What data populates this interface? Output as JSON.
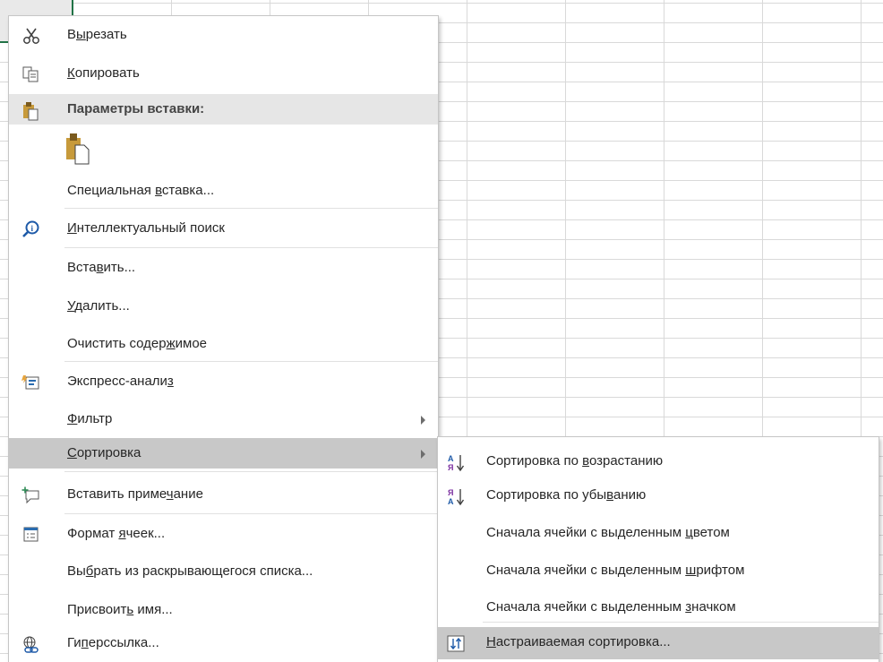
{
  "context_menu": {
    "cut": {
      "pre": "В",
      "key": "ы",
      "post": "резать"
    },
    "copy": {
      "pre": "",
      "key": "К",
      "post": "опировать"
    },
    "paste_options_header": "Параметры вставки:",
    "paste_special": {
      "pre": "Специальная ",
      "key": "в",
      "post": "ставка..."
    },
    "smart_lookup": {
      "pre": "",
      "key": "И",
      "post": "нтеллектуальный поиск"
    },
    "insert": {
      "pre": "Вста",
      "key": "в",
      "post": "ить..."
    },
    "delete": {
      "pre": "",
      "key": "У",
      "post": "далить..."
    },
    "clear_contents": {
      "pre": "Очистить содер",
      "key": "ж",
      "post": "имое"
    },
    "quick_analysis": {
      "pre": "Экспресс-анали",
      "key": "з",
      "post": ""
    },
    "filter": {
      "pre": "",
      "key": "Ф",
      "post": "ильтр"
    },
    "sort": {
      "pre": "",
      "key": "С",
      "post": "ортировка"
    },
    "insert_comment": {
      "pre": "Вставить приме",
      "key": "ч",
      "post": "ание"
    },
    "format_cells": {
      "pre": "Формат ",
      "key": "я",
      "post": "чеек..."
    },
    "pick_from_list": {
      "pre": "Вы",
      "key": "б",
      "post": "рать из раскрывающегося списка..."
    },
    "define_name": {
      "pre": "Присвоит",
      "key": "ь",
      "post": " имя..."
    },
    "hyperlink": {
      "pre": "Ги",
      "key": "п",
      "post": "ерссылка..."
    }
  },
  "sort_submenu": {
    "ascending": {
      "pre": "Сортировка по ",
      "key": "в",
      "post": "озрастанию"
    },
    "descending": {
      "pre": "Сортировка по убы",
      "key": "в",
      "post": "анию"
    },
    "color_first": {
      "pre": "Сначала ячейки с выделенным ",
      "key": "ц",
      "post": "ветом"
    },
    "font_first": {
      "pre": "Сначала ячейки с выделенным ",
      "key": "ш",
      "post": "рифтом"
    },
    "icon_first": {
      "pre": "Сначала ячейки с выделенным ",
      "key": "з",
      "post": "начком"
    },
    "custom_sort": {
      "pre": "",
      "key": "Н",
      "post": "астраиваемая сортировка..."
    },
    "icon_letters": {
      "a": "А",
      "ya": "Я"
    }
  },
  "colors": {
    "hover": "#c8c8c8",
    "header_bg": "#e6e6e6",
    "clipboard": "#c79a3b",
    "cell_border": "#217346"
  },
  "icons": [
    "scissors-icon",
    "copy-icon",
    "paste-icon",
    "paste-option-icon",
    "smart-lookup-icon",
    "quick-analysis-icon",
    "new-comment-icon",
    "format-cells-icon",
    "hyperlink-icon",
    "sort-asc-icon",
    "sort-desc-icon",
    "custom-sort-icon"
  ]
}
